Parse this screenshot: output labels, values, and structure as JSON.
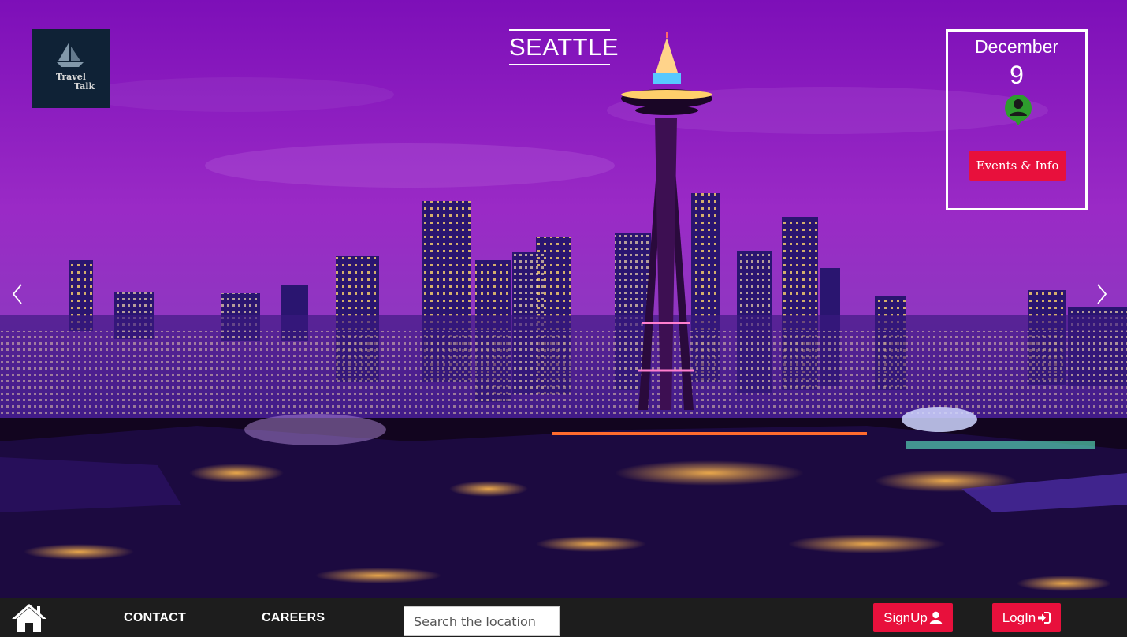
{
  "logo": {
    "line1": "Travel",
    "line2": "Talk"
  },
  "hero": {
    "city": "SEATTLE"
  },
  "info_box": {
    "month": "December",
    "day": "9",
    "events_label": "Events & Info",
    "user_icon": "user-marker-icon",
    "icon_color": "#2e9c2e"
  },
  "carousel": {
    "prev_icon": "chevron-left-icon",
    "next_icon": "chevron-right-icon"
  },
  "nav": {
    "home_icon": "home-icon",
    "contact": "CONTACT",
    "careers": "CAREERS",
    "search_placeholder": "Search the location",
    "signup": "SignUp",
    "signup_icon": "user-icon",
    "login": "LogIn",
    "login_icon": "sign-in-icon"
  },
  "colors": {
    "accent": "#e8103c",
    "nav_bg": "#1d1d1d",
    "sky": "#8a1fb8",
    "logo_bg": "#0f2236"
  }
}
